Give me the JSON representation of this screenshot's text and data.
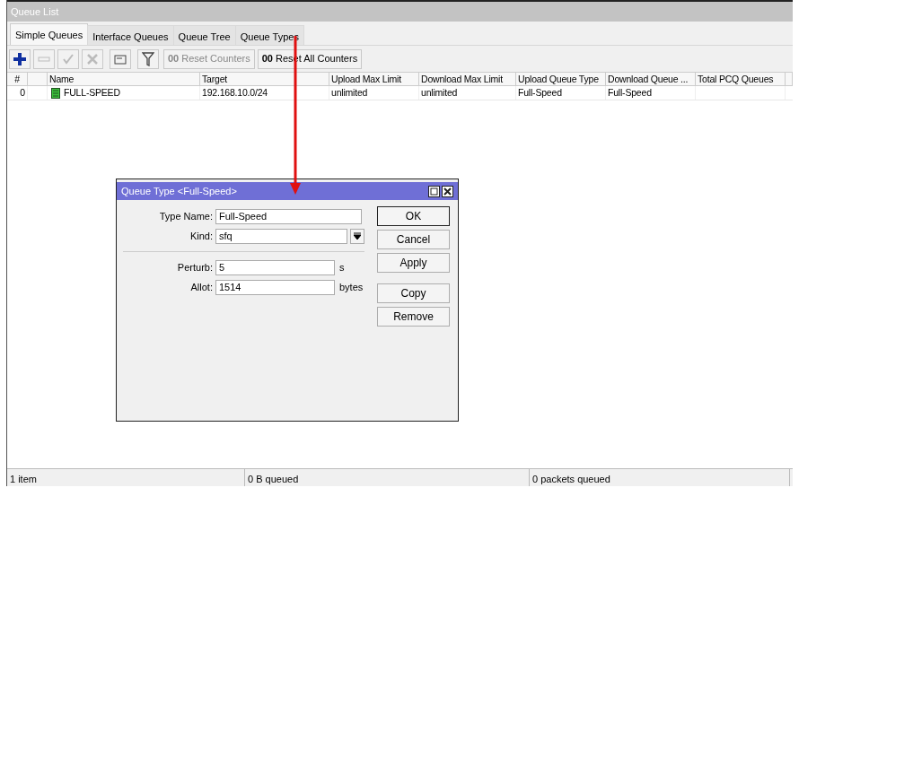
{
  "window": {
    "title": "Queue List"
  },
  "tabs": [
    {
      "label": "Simple Queues",
      "selected": true
    },
    {
      "label": "Interface Queues",
      "selected": false
    },
    {
      "label": "Queue Tree",
      "selected": false
    },
    {
      "label": "Queue Types",
      "selected": false
    }
  ],
  "toolbar": [
    {
      "kind": "add",
      "disabled": false
    },
    {
      "kind": "remove",
      "disabled": true
    },
    {
      "kind": "enable",
      "disabled": true
    },
    {
      "kind": "disable",
      "disabled": true
    },
    {
      "kind": "comment",
      "disabled": false
    },
    {
      "kind": "filter",
      "disabled": false
    },
    {
      "kind": "text",
      "label": "**00** Reset Counters",
      "disabled": true
    },
    {
      "kind": "text",
      "label": "**00** Reset All Counters",
      "disabled": false
    }
  ],
  "table": {
    "columns": [
      {
        "label": "#"
      },
      {
        "label": "Name"
      },
      {
        "label": "Target"
      },
      {
        "label": "Upload Max Limit"
      },
      {
        "label": "Download Max Limit"
      },
      {
        "label": "Upload Queue Type"
      },
      {
        "label": "Download Queue ..."
      },
      {
        "label": "Total PCQ Queues"
      }
    ],
    "rows": [
      {
        "enabled": true,
        "cells": [
          "0",
          "FULL-SPEED",
          "192.168.10.0/24",
          "unlimited",
          "unlimited",
          "Full-Speed",
          "Full-Speed"
        ]
      }
    ]
  },
  "status_bar": [
    "1 item",
    "0 B queued",
    "0 packets queued"
  ],
  "dialog": {
    "title": "Queue Type <Full-Speed>",
    "field_groups": [
      [
        {
          "kind": "text",
          "label": "Type Name:",
          "value": "Full-Speed"
        },
        {
          "kind": "select",
          "label": "Kind:",
          "value": "sfq"
        }
      ],
      [
        {
          "kind": "text",
          "label": "Perturb:",
          "value": "5",
          "unit": "s"
        },
        {
          "kind": "text",
          "label": "Allot:",
          "value": "1514",
          "unit": "bytes"
        }
      ]
    ],
    "button_groups": [
      [
        {
          "label": "OK",
          "default": true
        },
        {
          "label": "Cancel",
          "default": false
        },
        {
          "label": "Apply",
          "default": false
        }
      ],
      [
        {
          "label": "Copy",
          "default": false
        },
        {
          "label": "Remove",
          "default": false
        }
      ]
    ]
  }
}
